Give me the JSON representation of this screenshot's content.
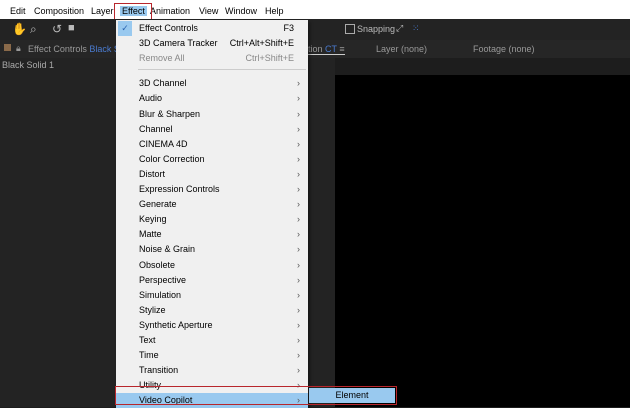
{
  "menubar": [
    "Edit",
    "Composition",
    "Layer",
    "Effect",
    "Animation",
    "View",
    "Window",
    "Help"
  ],
  "toolbar": {
    "snapping": "Snapping"
  },
  "panels": {
    "effect_controls": "Effect Controls",
    "effect_controls_target": "Black Soli",
    "composition": "tion",
    "comp_name": "CT",
    "layer": "Layer (none)",
    "footage": "Footage (none)",
    "layer_item": "Black Solid 1"
  },
  "menu": {
    "top": [
      {
        "label": "Effect Controls",
        "shortcut": "F3",
        "checked": true
      },
      {
        "label": "3D Camera Tracker",
        "shortcut": "Ctrl+Alt+Shift+E"
      },
      {
        "label": "Remove All",
        "shortcut": "Ctrl+Shift+E",
        "disabled": true
      }
    ],
    "items": [
      "3D Channel",
      "Audio",
      "Blur & Sharpen",
      "Channel",
      "CINEMA 4D",
      "Color Correction",
      "Distort",
      "Expression Controls",
      "Generate",
      "Keying",
      "Matte",
      "Noise & Grain",
      "Obsolete",
      "Perspective",
      "Simulation",
      "Stylize",
      "Synthetic Aperture",
      "Text",
      "Time",
      "Transition",
      "Utility",
      "Video Copilot"
    ],
    "submenu": [
      "Element"
    ]
  },
  "colors": {
    "highlight": "#99c9ef",
    "annotation": "#b8262c"
  }
}
